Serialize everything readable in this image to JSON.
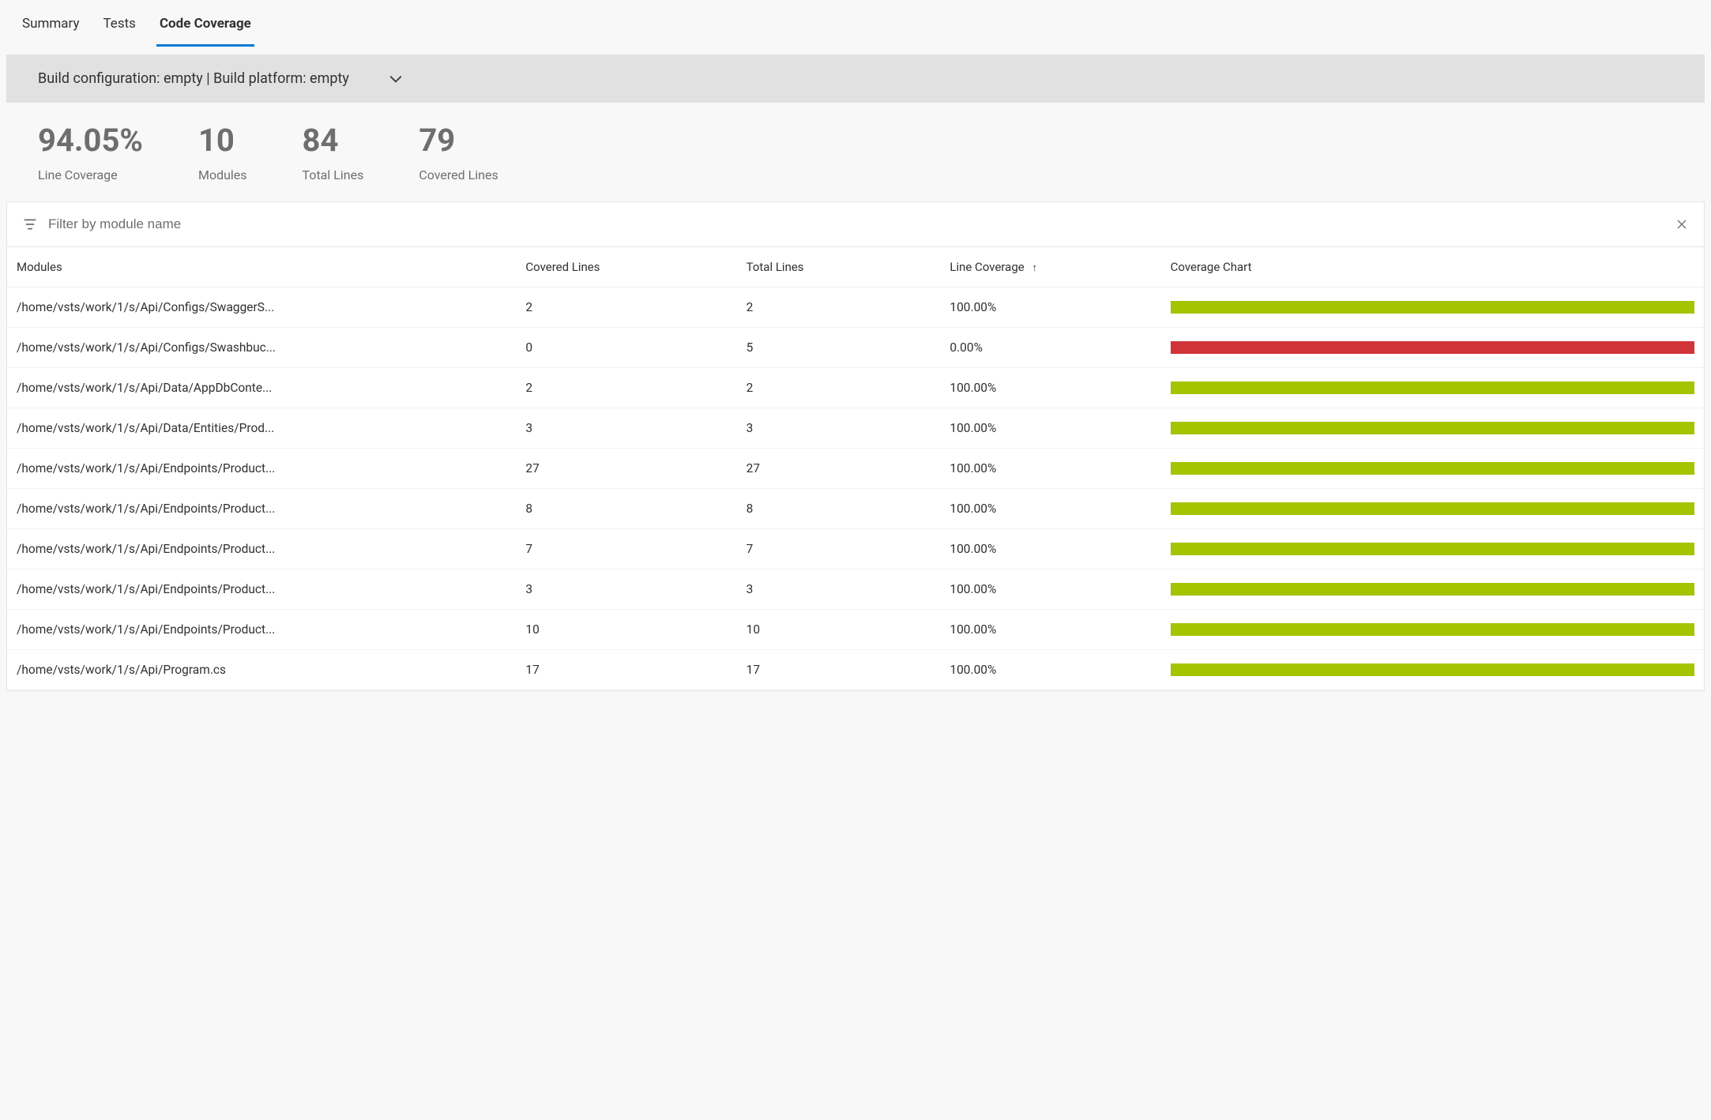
{
  "tabs": [
    {
      "label": "Summary",
      "active": false
    },
    {
      "label": "Tests",
      "active": false
    },
    {
      "label": "Code Coverage",
      "active": true
    }
  ],
  "accordion": {
    "text": "Build configuration: empty | Build platform: empty"
  },
  "stats": [
    {
      "value": "94.05%",
      "label": "Line Coverage"
    },
    {
      "value": "10",
      "label": "Modules"
    },
    {
      "value": "84",
      "label": "Total Lines"
    },
    {
      "value": "79",
      "label": "Covered Lines"
    }
  ],
  "filter": {
    "placeholder": "Filter by module name"
  },
  "table": {
    "headers": {
      "modules": "Modules",
      "covered": "Covered Lines",
      "total": "Total Lines",
      "coverage": "Line Coverage",
      "chart": "Coverage Chart"
    },
    "sort_arrow": "↑",
    "rows": [
      {
        "module": "/home/vsts/work/1/s/Api/Configs/SwaggerS...",
        "covered": "2",
        "total": "2",
        "coverage": "100.00%",
        "bar": "green"
      },
      {
        "module": "/home/vsts/work/1/s/Api/Configs/Swashbuc...",
        "covered": "0",
        "total": "5",
        "coverage": "0.00%",
        "bar": "red"
      },
      {
        "module": "/home/vsts/work/1/s/Api/Data/AppDbConte...",
        "covered": "2",
        "total": "2",
        "coverage": "100.00%",
        "bar": "green"
      },
      {
        "module": "/home/vsts/work/1/s/Api/Data/Entities/Prod...",
        "covered": "3",
        "total": "3",
        "coverage": "100.00%",
        "bar": "green"
      },
      {
        "module": "/home/vsts/work/1/s/Api/Endpoints/Product...",
        "covered": "27",
        "total": "27",
        "coverage": "100.00%",
        "bar": "green"
      },
      {
        "module": "/home/vsts/work/1/s/Api/Endpoints/Product...",
        "covered": "8",
        "total": "8",
        "coverage": "100.00%",
        "bar": "green"
      },
      {
        "module": "/home/vsts/work/1/s/Api/Endpoints/Product...",
        "covered": "7",
        "total": "7",
        "coverage": "100.00%",
        "bar": "green"
      },
      {
        "module": "/home/vsts/work/1/s/Api/Endpoints/Product...",
        "covered": "3",
        "total": "3",
        "coverage": "100.00%",
        "bar": "green"
      },
      {
        "module": "/home/vsts/work/1/s/Api/Endpoints/Product...",
        "covered": "10",
        "total": "10",
        "coverage": "100.00%",
        "bar": "green"
      },
      {
        "module": "/home/vsts/work/1/s/Api/Program.cs",
        "covered": "17",
        "total": "17",
        "coverage": "100.00%",
        "bar": "green"
      }
    ]
  }
}
